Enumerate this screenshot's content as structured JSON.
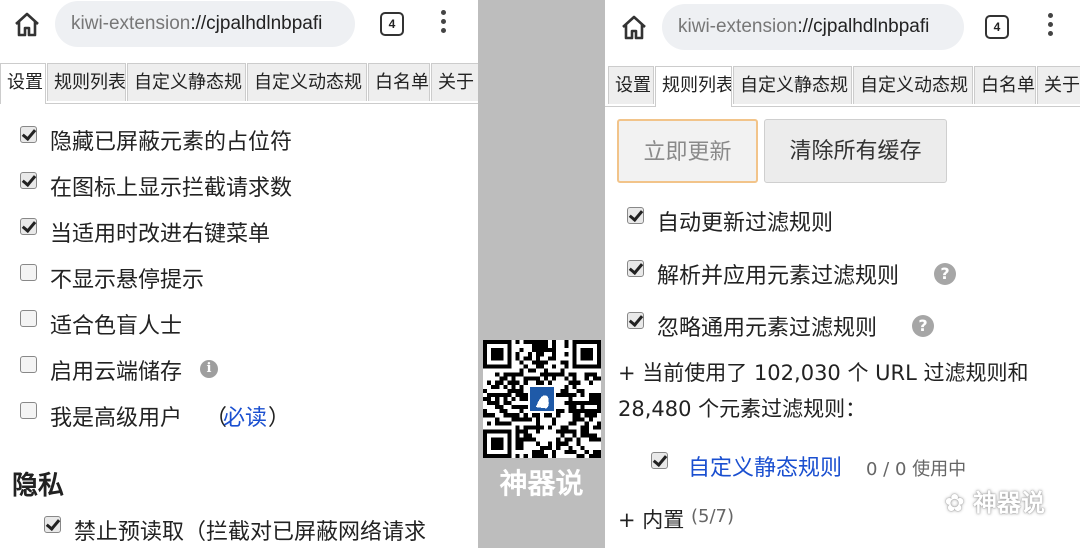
{
  "browser": {
    "url_scheme": "kiwi-extension",
    "url_rest": "://cjpalhdlnbpafi",
    "tab_count": "4"
  },
  "left": {
    "tabs": [
      "设置",
      "规则列表",
      "自定义静态规",
      "自定义动态规",
      "白名单",
      "关于"
    ],
    "options": [
      {
        "label": "隐藏已屏蔽元素的占位符",
        "checked": true
      },
      {
        "label": "在图标上显示拦截请求数",
        "checked": true
      },
      {
        "label": "当适用时改进右键菜单",
        "checked": true
      },
      {
        "label": "不显示悬停提示",
        "checked": false
      },
      {
        "label": "适合色盲人士",
        "checked": false
      },
      {
        "label": "启用云端储存",
        "checked": false
      },
      {
        "label": "我是高级用户",
        "checked": false
      }
    ],
    "must_read_prefix": "（",
    "must_read_link": "必读",
    "must_read_suffix": "）",
    "privacy_heading": "隐私",
    "privacy_option": "禁止预读取（拦截对已屏蔽网络请求"
  },
  "right": {
    "tabs": [
      "设置",
      "规则列表",
      "自定义静态规",
      "自定义动态规",
      "白名单",
      "关于"
    ],
    "update_button": "立即更新",
    "clear_button": "清除所有缓存",
    "options": [
      {
        "label": "自动更新过滤规则",
        "checked": true
      },
      {
        "label": "解析并应用元素过滤规则",
        "checked": true
      },
      {
        "label": "忽略通用元素过滤规则",
        "checked": true
      }
    ],
    "summary_line1": "+ 当前使用了 102,030 个 URL 过滤规则和",
    "summary_line2": "28,480 个元素过滤规则：",
    "custom_rules_link": "自定义静态规则",
    "custom_rules_count": "0 / 0 使用中",
    "builtin_prefix": "+ 内置",
    "builtin_count": "(5/7)"
  },
  "middle": {
    "brand": "神器说"
  },
  "watermark": "神器说"
}
